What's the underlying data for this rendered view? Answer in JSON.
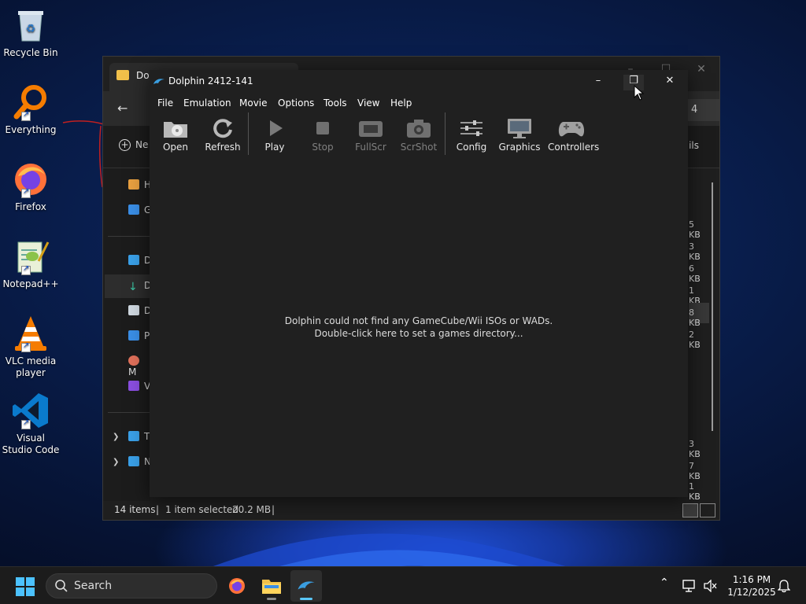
{
  "desktop": {
    "icons": [
      {
        "label": "Recycle Bin"
      },
      {
        "label": "Everything"
      },
      {
        "label": "Firefox"
      },
      {
        "label": "Notepad++"
      },
      {
        "label": "VLC media player"
      },
      {
        "label": "Visual Studio Code"
      }
    ]
  },
  "explorer": {
    "tab_title": "Dol",
    "address_fragment": "4",
    "new_label": "Ne",
    "details_label": "ails",
    "sidebar": [
      "H",
      "G",
      "D",
      "D",
      "D",
      "P",
      "M",
      "V",
      "T",
      "N"
    ],
    "sizes": [
      "5 KB",
      "3 KB",
      "6 KB",
      "1 KB",
      "8 KB",
      "2 KB",
      "3 KB",
      "7 KB",
      "1 KB"
    ],
    "status": {
      "items": "14 items",
      "separator": "|",
      "selected": "1 item selected",
      "size": "20.2 MB",
      "separator2": "|"
    }
  },
  "dolphin": {
    "title": "Dolphin 2412-141",
    "menu": [
      "File",
      "Emulation",
      "Movie",
      "Options",
      "Tools",
      "View",
      "Help"
    ],
    "toolbar": [
      {
        "label": "Open",
        "enabled": true
      },
      {
        "label": "Refresh",
        "enabled": true
      },
      {
        "label": "Play",
        "enabled": true
      },
      {
        "label": "Stop",
        "enabled": false
      },
      {
        "label": "FullScr",
        "enabled": false
      },
      {
        "label": "ScrShot",
        "enabled": false
      },
      {
        "label": "Config",
        "enabled": true
      },
      {
        "label": "Graphics",
        "enabled": true
      },
      {
        "label": "Controllers",
        "enabled": true
      }
    ],
    "message_line1": "Dolphin could not find any GameCube/Wii ISOs or WADs.",
    "message_line2": "Double-click here to set a games directory..."
  },
  "taskbar": {
    "search_label": "Search",
    "apps": [
      "firefox-icon",
      "file-explorer-icon",
      "dolphin-icon"
    ],
    "time": "1:16 PM",
    "date": "1/12/2025"
  },
  "colors": {
    "window_bg": "#202020",
    "taskbar_bg": "#1c1c1c",
    "accent": "#5ac8fa",
    "folder": "#f1c04a"
  }
}
